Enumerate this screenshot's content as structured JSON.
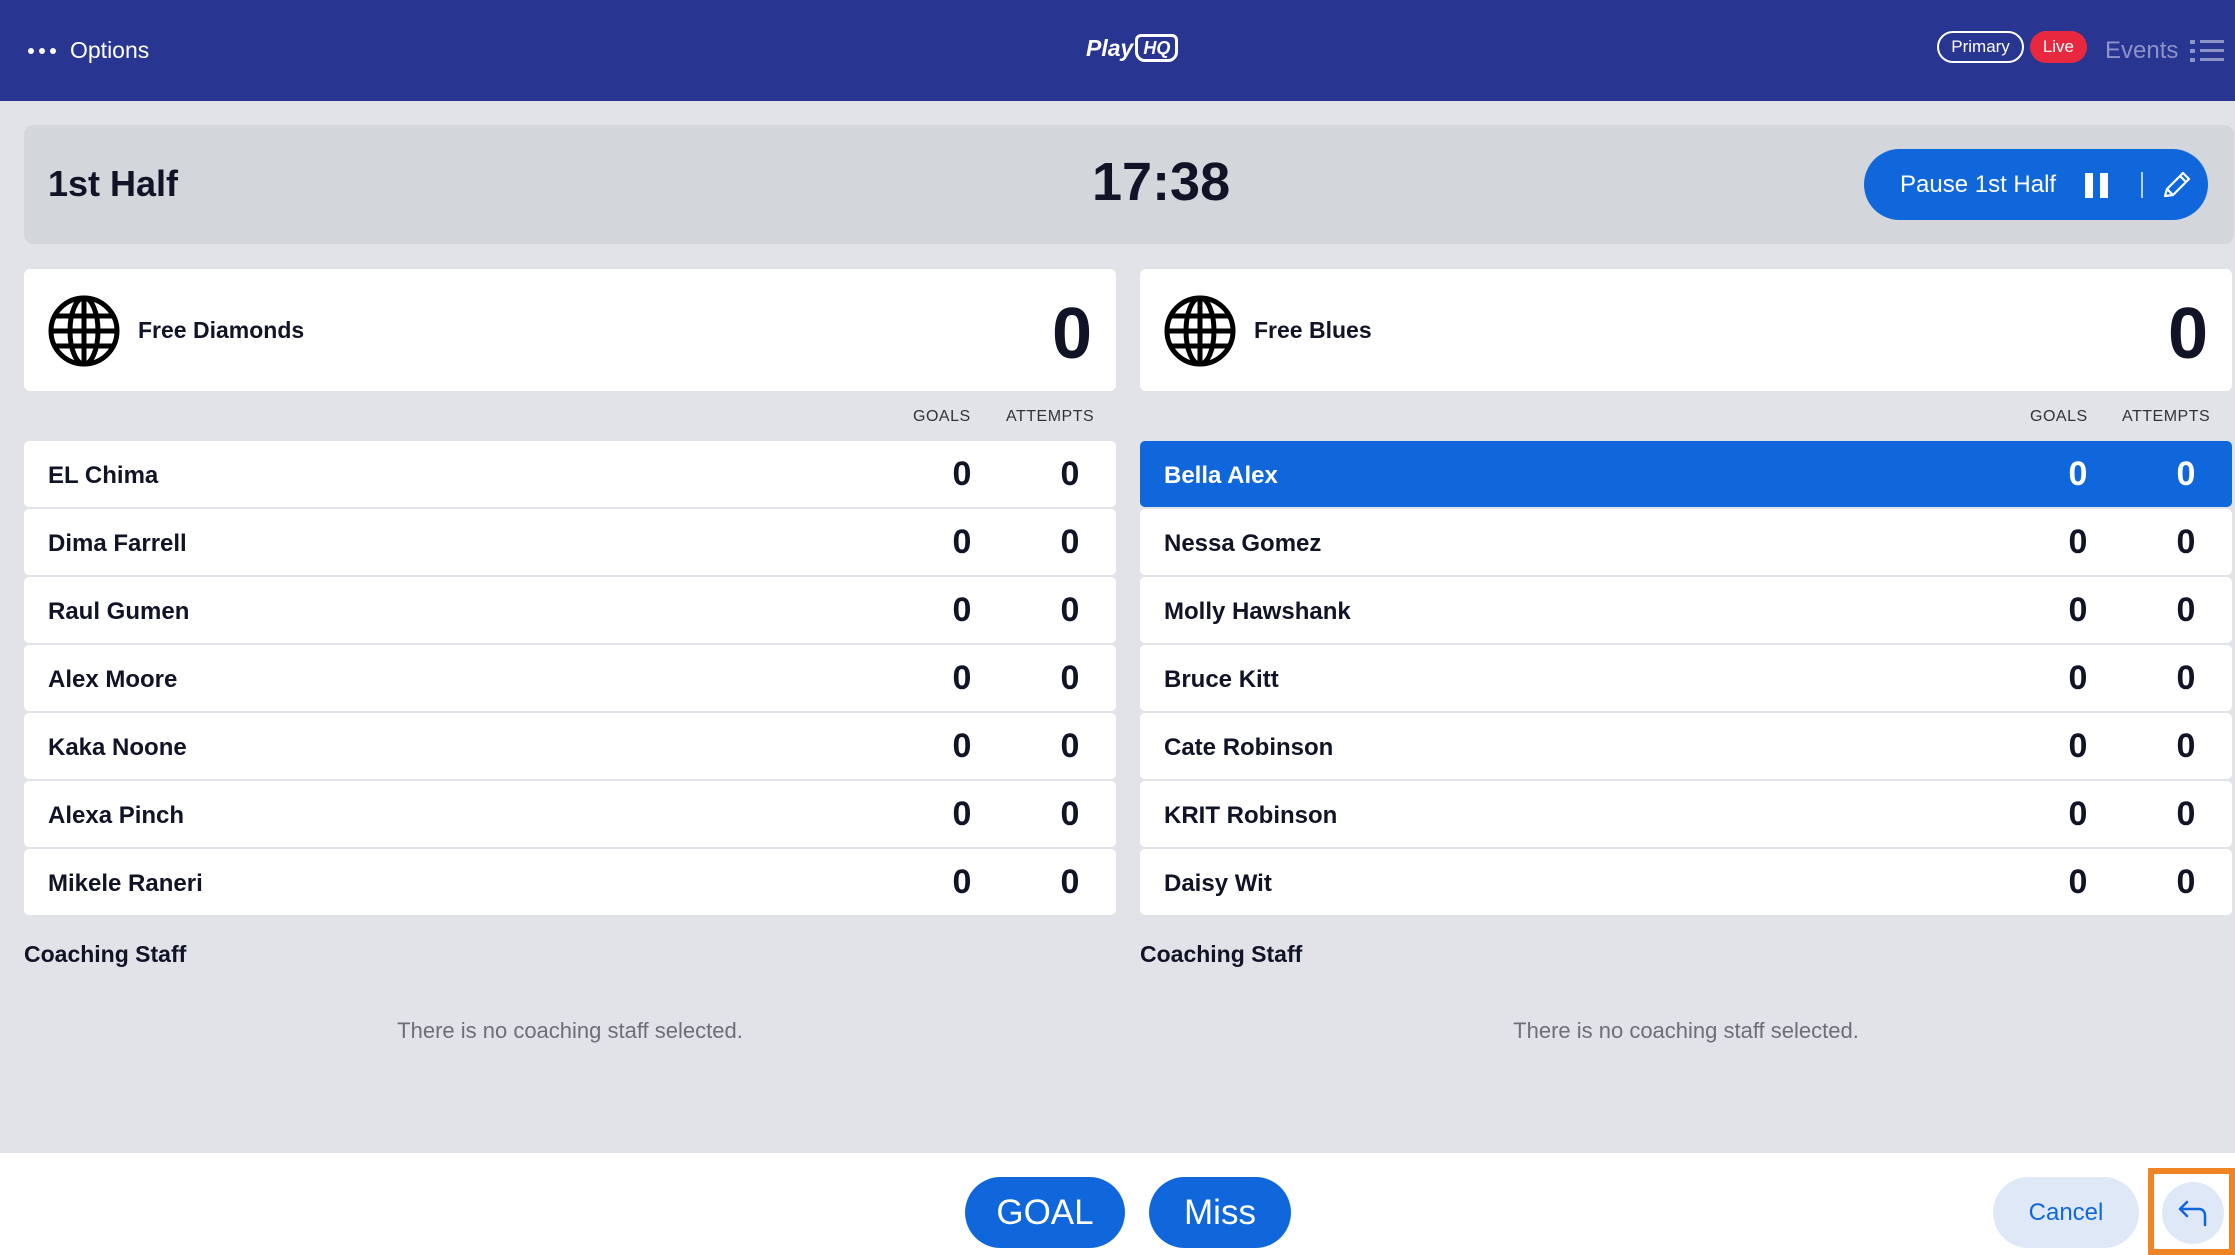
{
  "header": {
    "options_label": "Options",
    "logo_play": "Play",
    "logo_hq": "HQ",
    "badge_primary": "Primary",
    "badge_live": "Live",
    "events_label": "Events"
  },
  "period": {
    "title": "1st Half",
    "clock": "17:38",
    "pause_label": "Pause 1st Half"
  },
  "columns": {
    "goals": "GOALS",
    "attempts": "ATTEMPTS"
  },
  "teams": [
    {
      "name": "Free Diamonds",
      "score": "0",
      "players": [
        {
          "name": "EL Chima",
          "goals": "0",
          "attempts": "0",
          "selected": false
        },
        {
          "name": "Dima Farrell",
          "goals": "0",
          "attempts": "0",
          "selected": false
        },
        {
          "name": "Raul Gumen",
          "goals": "0",
          "attempts": "0",
          "selected": false
        },
        {
          "name": "Alex Moore",
          "goals": "0",
          "attempts": "0",
          "selected": false
        },
        {
          "name": "Kaka Noone",
          "goals": "0",
          "attempts": "0",
          "selected": false
        },
        {
          "name": "Alexa Pinch",
          "goals": "0",
          "attempts": "0",
          "selected": false
        },
        {
          "name": "Mikele Raneri",
          "goals": "0",
          "attempts": "0",
          "selected": false
        }
      ],
      "coaching_title": "Coaching Staff",
      "coaching_empty": "There is no coaching staff selected."
    },
    {
      "name": "Free Blues",
      "score": "0",
      "players": [
        {
          "name": "Bella Alex",
          "goals": "0",
          "attempts": "0",
          "selected": true
        },
        {
          "name": "Nessa Gomez",
          "goals": "0",
          "attempts": "0",
          "selected": false
        },
        {
          "name": "Molly Hawshank",
          "goals": "0",
          "attempts": "0",
          "selected": false
        },
        {
          "name": "Bruce Kitt",
          "goals": "0",
          "attempts": "0",
          "selected": false
        },
        {
          "name": "Cate Robinson",
          "goals": "0",
          "attempts": "0",
          "selected": false
        },
        {
          "name": "KRIT Robinson",
          "goals": "0",
          "attempts": "0",
          "selected": false
        },
        {
          "name": "Daisy Wit",
          "goals": "0",
          "attempts": "0",
          "selected": false
        }
      ],
      "coaching_title": "Coaching Staff",
      "coaching_empty": "There is no coaching staff selected."
    }
  ],
  "actions": {
    "goal_label": "GOAL",
    "miss_label": "Miss",
    "cancel_label": "Cancel"
  },
  "colors": {
    "header_bg": "#283591",
    "accent": "#1067db",
    "live": "#e8283f",
    "highlight": "#f08425"
  },
  "icons": {
    "options": "more-dots-icon",
    "events": "list-icon",
    "pause": "pause-icon",
    "edit": "pencil-icon",
    "team": "globe-icon",
    "undo": "undo-arrow-icon"
  }
}
